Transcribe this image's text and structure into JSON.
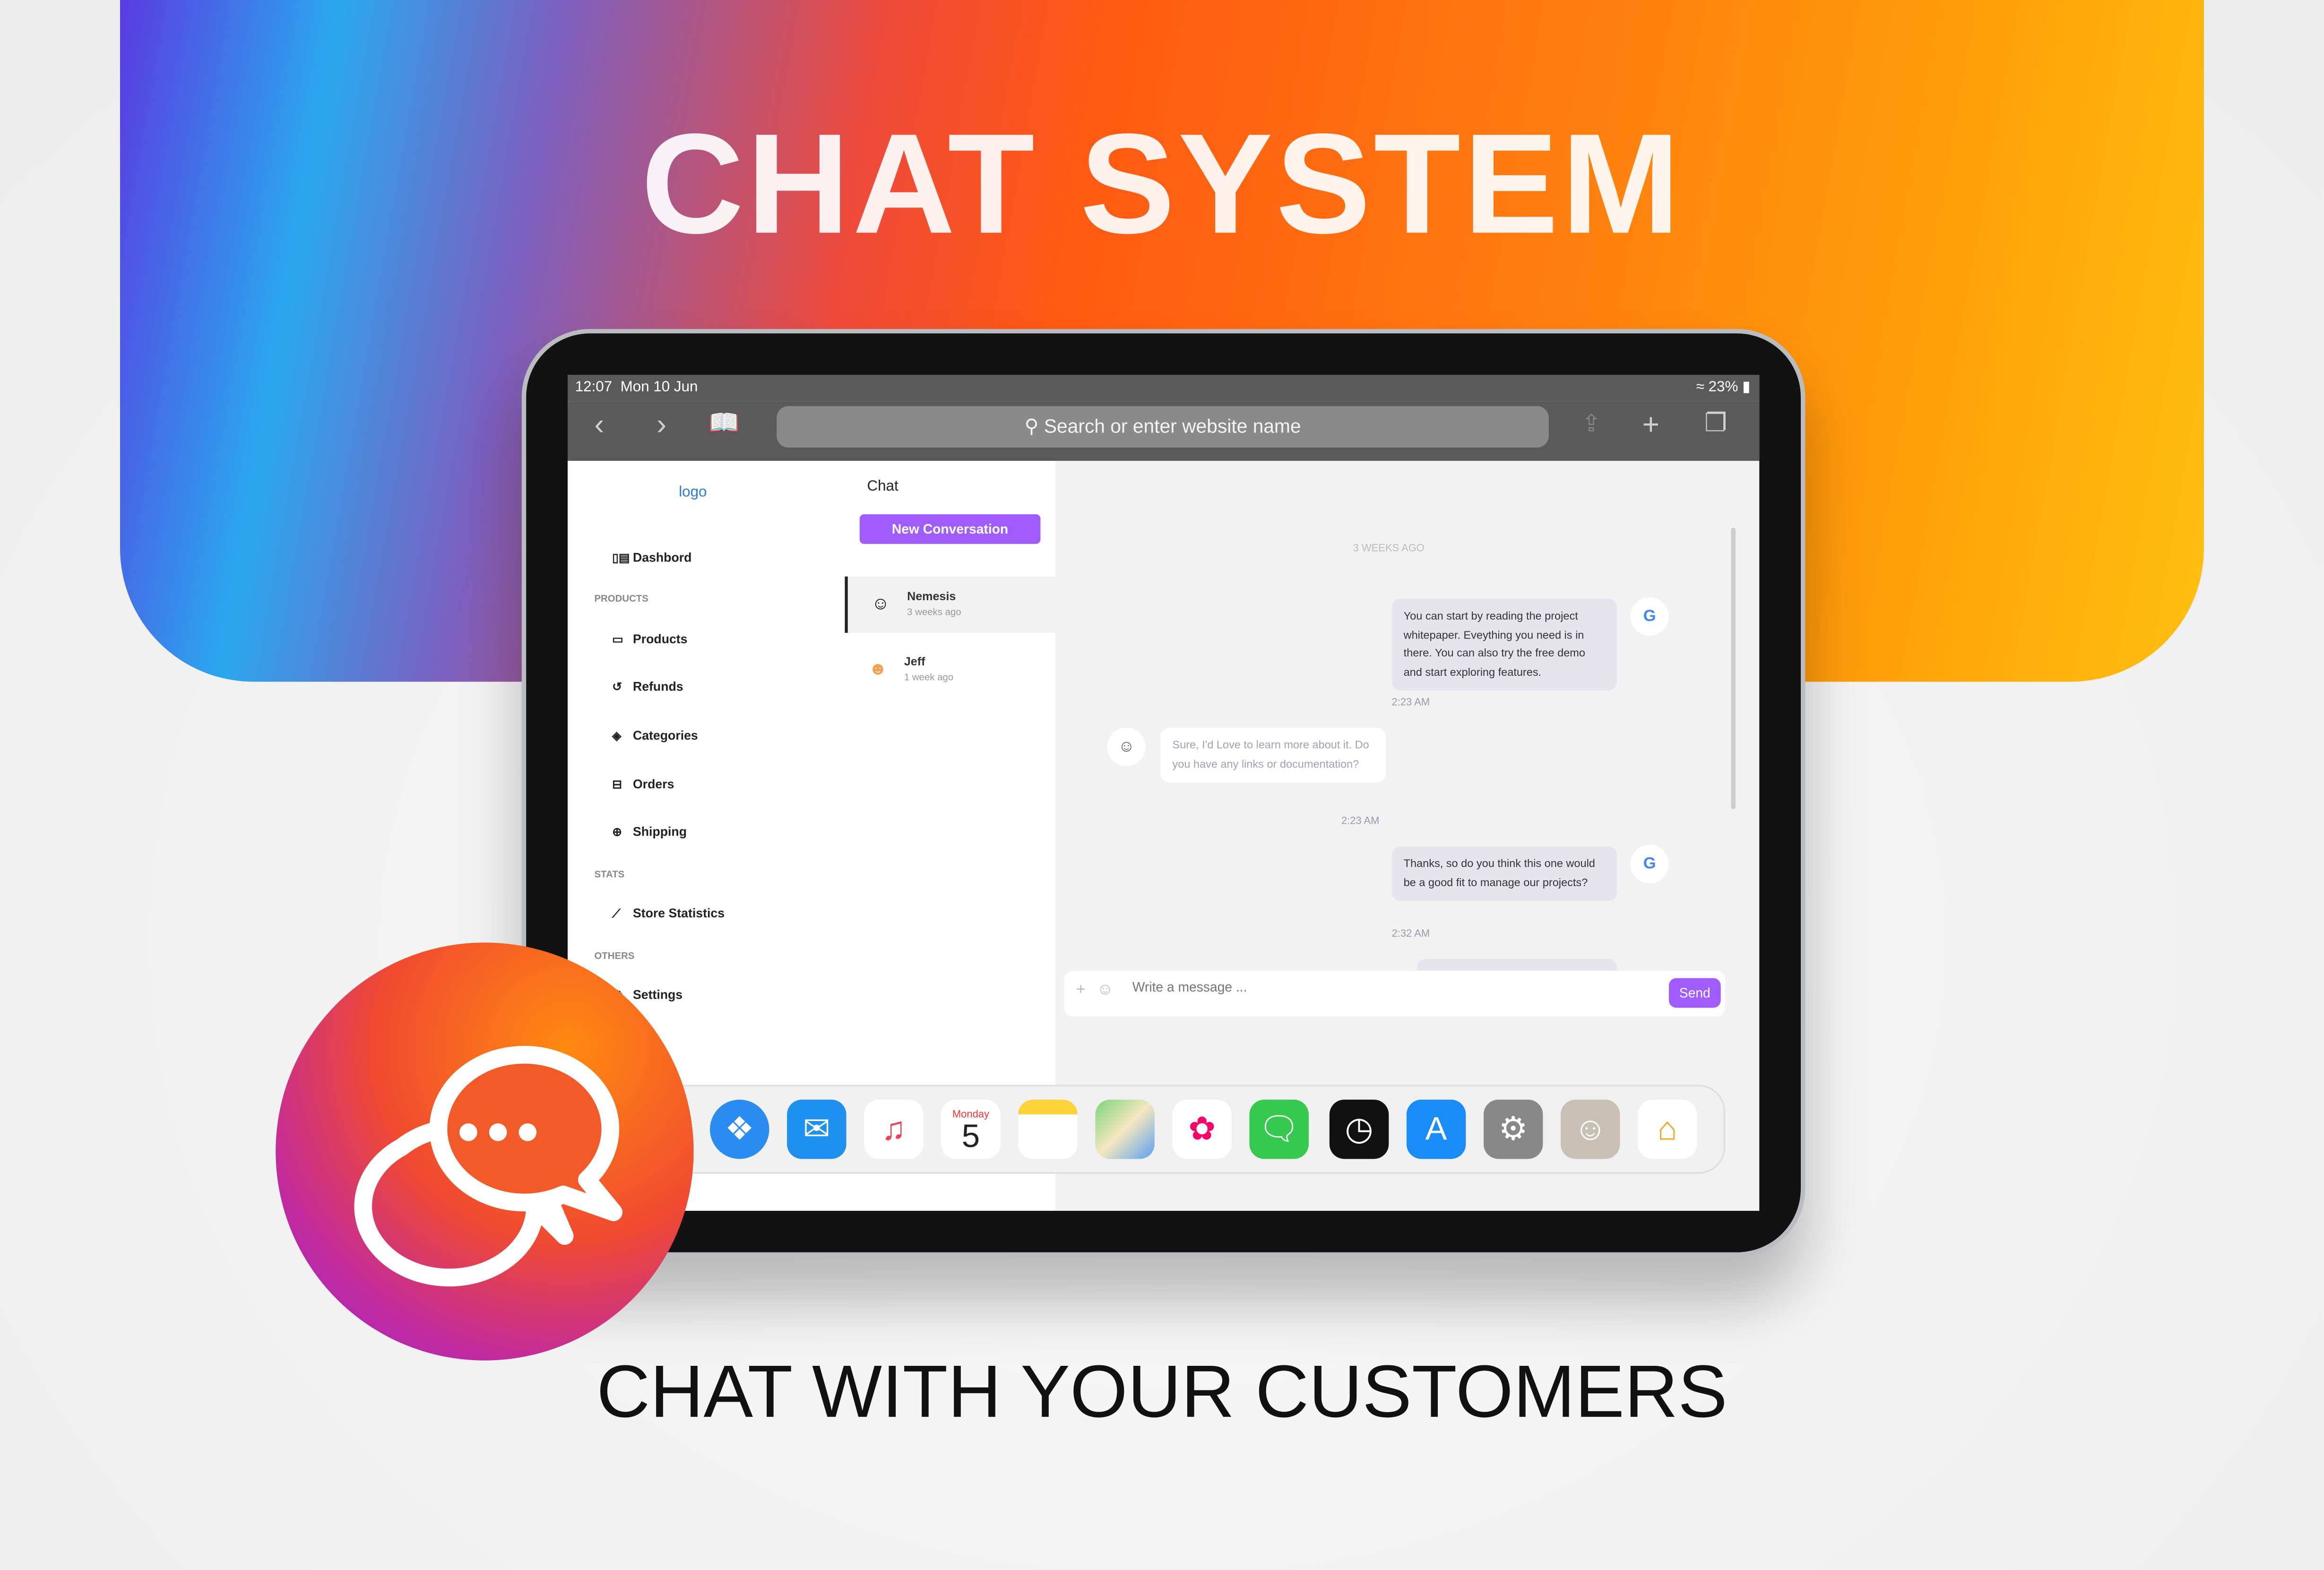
{
  "headline": "CHAT SYSTEM",
  "tagline": "CHAT WITH YOUR CUSTOMERS",
  "status": {
    "time": "12:07",
    "date": "Mon 10 Jun",
    "battery": "23%"
  },
  "browser": {
    "url_placeholder": "Search or enter website name"
  },
  "sidebar": {
    "logo_alt": "logo",
    "items": [
      {
        "label": "Dashbord",
        "icon": "dashboard-icon"
      },
      {
        "label": "Products",
        "icon": "inbox-icon"
      },
      {
        "label": "Refunds",
        "icon": "refund-icon"
      },
      {
        "label": "Categories",
        "icon": "tag-icon"
      },
      {
        "label": "Orders",
        "icon": "briefcase-icon"
      },
      {
        "label": "Shipping",
        "icon": "globe-icon"
      },
      {
        "label": "Store Statistics",
        "icon": "chart-line-icon"
      },
      {
        "label": "Settings",
        "icon": "gear-icon"
      }
    ],
    "sections": [
      "PRODUCTS",
      "STATS",
      "OTHERS"
    ]
  },
  "conversations": {
    "title": "Chat",
    "new_button": "New Conversation",
    "items": [
      {
        "name": "Nemesis",
        "time": "3 weeks ago"
      },
      {
        "name": "Jeff",
        "time": "1 week ago"
      }
    ]
  },
  "chat": {
    "divider": "3 WEEKS AGO",
    "messages": [
      {
        "dir": "out",
        "text": "You can start by reading the project whitepaper. Eveything you need is in there. You can also try the free demo and start exploring features.",
        "time": "2:23 AM"
      },
      {
        "dir": "in",
        "text": "Sure, I'd Love to learn more about it. Do you have any links or documentation?",
        "time": "2:23 AM"
      },
      {
        "dir": "out",
        "text": "Thanks, so do you think this one would be a good fit to manage our projects?",
        "time": "2:32 AM"
      }
    ],
    "input_placeholder": "Write a message ...",
    "send": "Send"
  },
  "dock": {
    "calendar_day": "Monday",
    "calendar_date": "5",
    "apps": [
      "safari",
      "mail",
      "music",
      "calendar",
      "notes",
      "maps",
      "photos",
      "messages",
      "clock",
      "app-store",
      "settings",
      "contacts",
      "home"
    ]
  },
  "colors": {
    "accent": "#a05cff"
  }
}
